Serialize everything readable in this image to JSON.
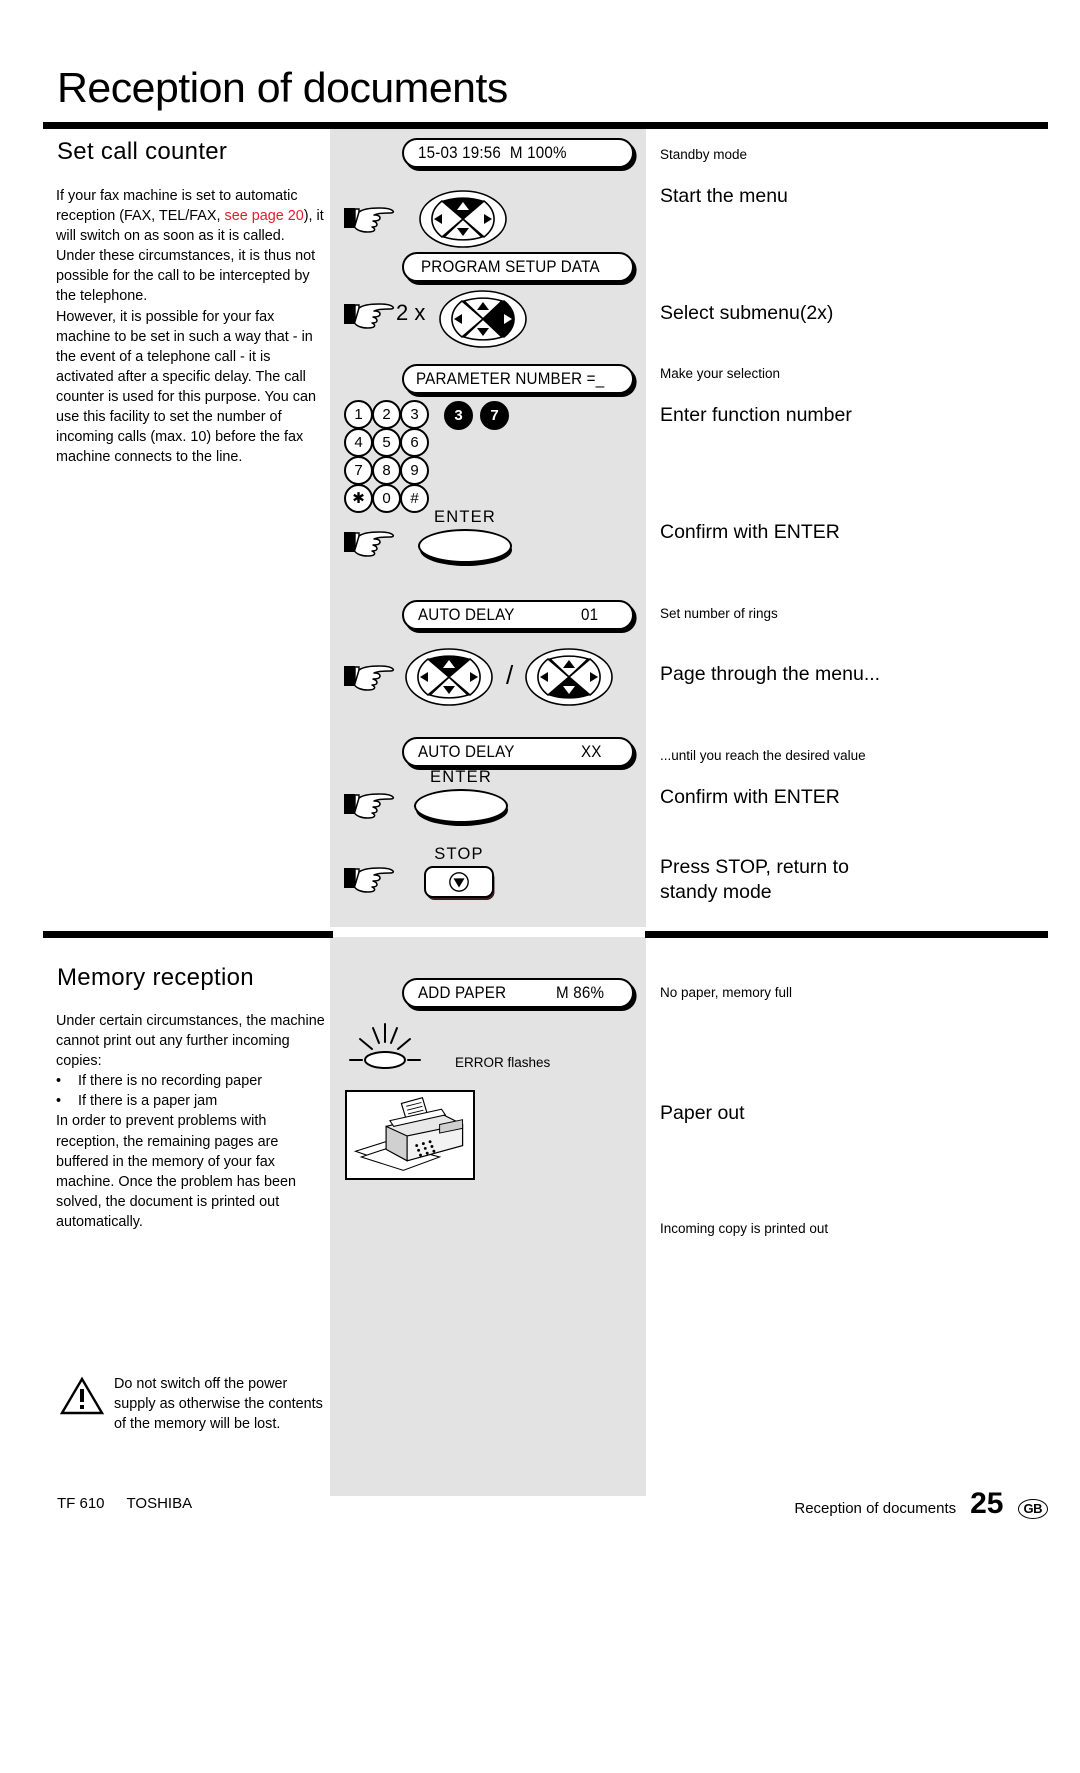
{
  "document": {
    "title": "Reception of documents"
  },
  "sections": [
    {
      "heading": "Set call counter",
      "paragraphs": [
        "If your fax machine is set to automatic reception (FAX, TEL/FAX, ",
        "see page 20",
        "), it will switch on as soon as it is called. Under these circumstances, it is thus not possible for the call to be intercepted by the telephone.",
        "However, it is possible for your fax machine to be set in such a way that - in the event of a telephone call - it is activated after a specific delay. The call counter is used for this purpose. You can use this facility to set the number of incoming calls (max. 10) before the fax machine connects to the line."
      ]
    },
    {
      "heading": "Memory reception",
      "intro": "Under certain circumstances, the machine cannot print out any further incoming copies:",
      "bullets": [
        "If there is no recording paper",
        "If there is a paper jam"
      ],
      "outro": "In order to prevent problems with reception, the remaining pages are buffered in the memory of your fax machine. Once the problem has been solved, the document is printed out automatically.",
      "warning": "Do not switch off the power supply as otherwise the contents of the memory will be lost."
    }
  ],
  "steps": {
    "display_1": {
      "label": "15-03 19:56  M 100%"
    },
    "display_2": {
      "label": "PROGRAM SETUP DATA"
    },
    "display_3": {
      "label": "PARAMETER NUMBER =_"
    },
    "display_4": {
      "label": "AUTO DELAY",
      "value": "01"
    },
    "display_5": {
      "label": "AUTO DELAY",
      "value": "XX"
    },
    "display_6": {
      "label": "ADD PAPER",
      "value": "M 86%"
    },
    "multiplier_2x": "2 x",
    "enter_label_1": "ENTER",
    "enter_label_2": "ENTER",
    "stop_label": "STOP",
    "separator_slash": "/",
    "error_caption": "ERROR flashes",
    "keypad": {
      "rows": [
        [
          "1",
          "2",
          "3"
        ],
        [
          "4",
          "5",
          "6"
        ],
        [
          "7",
          "8",
          "9"
        ],
        [
          "✱",
          "0",
          "#"
        ]
      ],
      "highlighted": [
        "3",
        "7"
      ]
    }
  },
  "captions": [
    {
      "text": "Standby mode",
      "size": "small"
    },
    {
      "text": "Start the menu",
      "size": "big"
    },
    {
      "text": "Select submenu(2x)",
      "size": "big"
    },
    {
      "text": "Make your selection",
      "size": "small"
    },
    {
      "text": "Enter function number",
      "size": "big"
    },
    {
      "text": "Confirm with ENTER",
      "size": "big"
    },
    {
      "text": "Set number of rings",
      "size": "small"
    },
    {
      "text": "Page through the menu...",
      "size": "big"
    },
    {
      "text": "...until you reach the desired value",
      "size": "small"
    },
    {
      "text": "Confirm with ENTER",
      "size": "big"
    },
    {
      "text": "Press STOP, return to standy mode",
      "size": "big"
    },
    {
      "text": "No paper, memory full",
      "size": "small"
    },
    {
      "text": "Paper out",
      "size": "big"
    },
    {
      "text": "Incoming copy is printed out",
      "size": "small"
    }
  ],
  "footer": {
    "model": "TF 610",
    "brand": "TOSHIBA",
    "section": "Reception of documents",
    "page": "25",
    "region": "GB"
  },
  "colors": {
    "band": "#e3e3e3",
    "link_red": "#e8192c",
    "ink": "#000000"
  },
  "icons": {
    "hand": "pointing-hand-icon",
    "navpad": "navigation-pad-icon",
    "warn": "warning-triangle-icon",
    "led": "flashing-led-icon",
    "printer": "fax-machine-illustration",
    "stop": "stop-symbol-icon"
  }
}
